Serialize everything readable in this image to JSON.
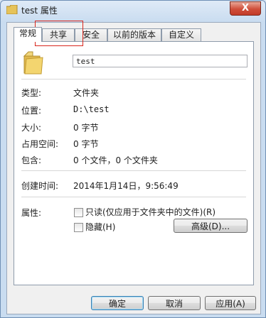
{
  "window": {
    "title": "test 属性",
    "close_glyph": "X"
  },
  "tabs": [
    "常规",
    "共享",
    "安全",
    "以前的版本",
    "自定义"
  ],
  "general": {
    "name_value": "test",
    "type_label": "类型:",
    "type_value": "文件夹",
    "location_label": "位置:",
    "location_value": "D:\\test",
    "size_label": "大小:",
    "size_value": "0 字节",
    "size_on_disk_label": "占用空间:",
    "size_on_disk_value": "0 字节",
    "contains_label": "包含:",
    "contains_value": "0 个文件，0 个文件夹",
    "created_label": "创建时间:",
    "created_value": "2014年1月14日，9:56:49",
    "attributes_label": "属性:",
    "readonly_label": "只读(仅应用于文件夹中的文件)(R)",
    "hidden_label": "隐藏(H)",
    "advanced_button": "高级(D)..."
  },
  "footer": {
    "ok": "确定",
    "cancel": "取消",
    "apply": "应用(A)"
  },
  "colors": {
    "close_button": "#c23b28",
    "annotation_box": "#d9261c",
    "folder": "#e8c760"
  }
}
